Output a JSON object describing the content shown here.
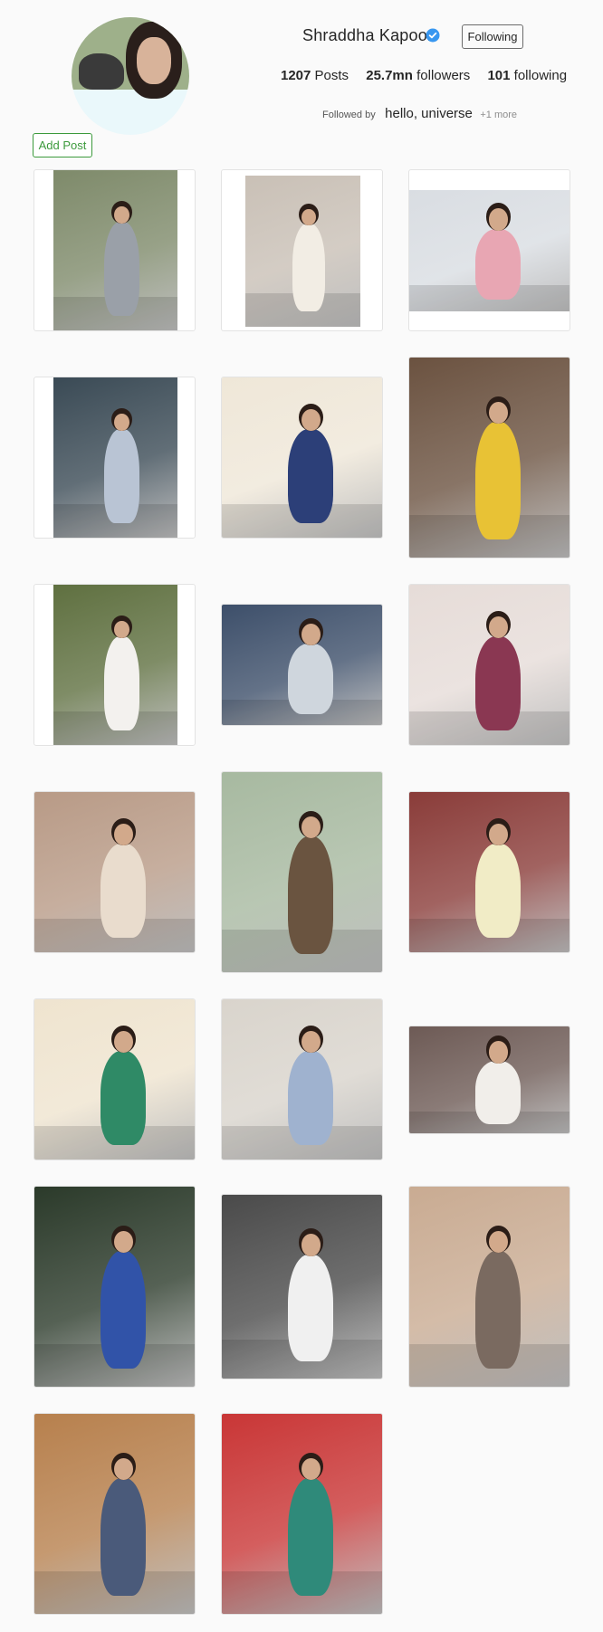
{
  "profile": {
    "username": "Shraddha Kapoor",
    "verified_icon": "verified-badge-icon",
    "follow_button": "Following",
    "stats": [
      {
        "value": "1207",
        "label": "Posts"
      },
      {
        "value": "25.7mn",
        "label": "followers"
      },
      {
        "value": "101",
        "label": "following"
      }
    ],
    "followed_by_label": "Followed by",
    "followed_by_names": "hello, universe",
    "followed_by_more": "+1 more",
    "add_post_button": "Add Post"
  },
  "colors": {
    "accent_green": "#3c9a3c",
    "verified_blue": "#3897f0",
    "background": "#fafafa"
  },
  "posts": [
    {
      "scene": "cafe",
      "bg": "#7e8a6a",
      "dress": "#9aa0a8"
    },
    {
      "scene": "white-kurta",
      "bg": "#c9c0b6",
      "dress": "#f2ede4"
    },
    {
      "scene": "easel",
      "bg": "#d9dde2",
      "dress": "#e8a6b3"
    },
    {
      "scene": "red-car",
      "bg": "#3a4a55",
      "dress": "#b9c4d4"
    },
    {
      "scene": "flowers",
      "bg": "#efe7d8",
      "dress": "#2c3f78"
    },
    {
      "scene": "yellow-lehenga",
      "bg": "#6b5240",
      "dress": "#e8c235"
    },
    {
      "scene": "garden-walk",
      "bg": "#5f7040",
      "dress": "#f3f1ee"
    },
    {
      "scene": "phone-glasses",
      "bg": "#3d4f6a",
      "dress": "#cfd6dd"
    },
    {
      "scene": "curls",
      "bg": "#e6dcd8",
      "dress": "#8a3752"
    },
    {
      "scene": "floral-gown",
      "bg": "#b89a86",
      "dress": "#e9dccd"
    },
    {
      "scene": "palms-lawn",
      "bg": "#a7b9a0",
      "dress": "#6a5440"
    },
    {
      "scene": "yellow-print",
      "bg": "#8a3c39",
      "dress": "#f1ecc6"
    },
    {
      "scene": "green-top",
      "bg": "#efe4cf",
      "dress": "#2f8a66"
    },
    {
      "scene": "blue-dress",
      "bg": "#d9d4cc",
      "dress": "#9fb2cf"
    },
    {
      "scene": "classroom",
      "bg": "#6d5a55",
      "dress": "#f1eeea"
    },
    {
      "scene": "saree",
      "bg": "#2b3a2a",
      "dress": "#3153a8"
    },
    {
      "scene": "bw-street",
      "bg": "#4a4a4a",
      "dress": "#f0f0f0"
    },
    {
      "scene": "museum-selfie",
      "bg": "#c9ab92",
      "dress": "#7a6a60"
    },
    {
      "scene": "sleepy",
      "bg": "#b7804d",
      "dress": "#4a5a7a"
    },
    {
      "scene": "scarf",
      "bg": "#c93636",
      "dress": "#2f8a7a"
    }
  ]
}
